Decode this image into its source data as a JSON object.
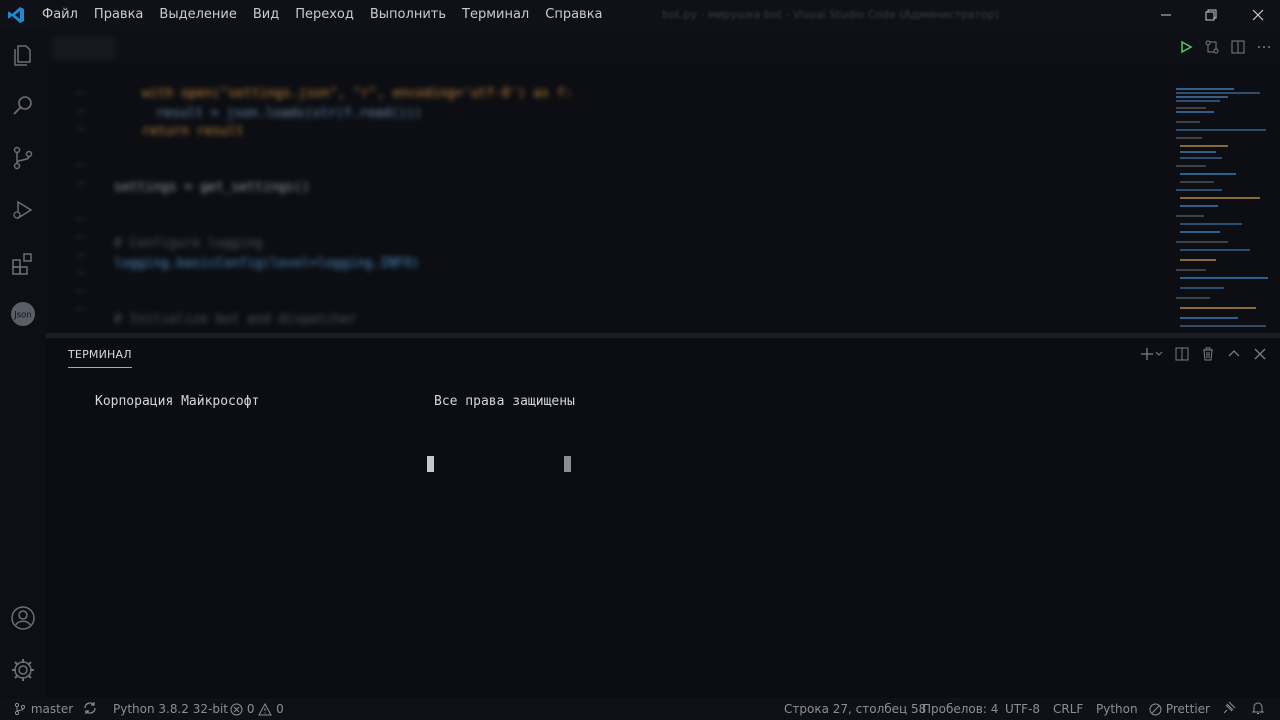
{
  "colors": {
    "accent": "#e7a04a",
    "background": "#0b0d12",
    "vscode_blue": "#1f8ad2",
    "run_green": "#4ec96b"
  },
  "titlebar": {
    "menu": [
      "Файл",
      "Правка",
      "Выделение",
      "Вид",
      "Переход",
      "Выполнить",
      "Терминал",
      "Справка"
    ],
    "active_menu": "Правка",
    "window_title": "bot.py - мирушка bot - Visual Studio Code (Администратор)"
  },
  "activity_bar": {
    "icons": [
      "files-icon",
      "search-icon",
      "source-control-icon",
      "run-debug-icon",
      "extensions-icon",
      "json-icon",
      "account-icon",
      "settings-gear-icon"
    ],
    "json_label": "Json"
  },
  "editor": {
    "tab_label": "bot.py",
    "code_lines": [
      "with open(\"settings.json\", \"r\", encoding='utf-8') as f:",
      "    result = json.loads(str(f.read()))",
      "return result",
      "",
      "settings = get_settings()",
      "",
      "# Configure logging",
      "logging.basicConfig(level=logging.INFO)",
      "",
      "# Initialize bot and dispatcher"
    ]
  },
  "panel": {
    "tab_label": "ТЕРМИНАЛ",
    "terminal": {
      "line1_left": "Корпорация Майкрософт",
      "line1_right": "Все права защищены"
    }
  },
  "statusbar": {
    "branch": "master",
    "interpreter": "Python 3.8.2 32-bit",
    "errors": "0",
    "warnings": "0",
    "cursor_position": "Строка 27, столбец 58",
    "indentation": "Пробелов: 4",
    "encoding": "UTF-8",
    "eol": "CRLF",
    "language": "Python",
    "formatter": "Prettier"
  }
}
